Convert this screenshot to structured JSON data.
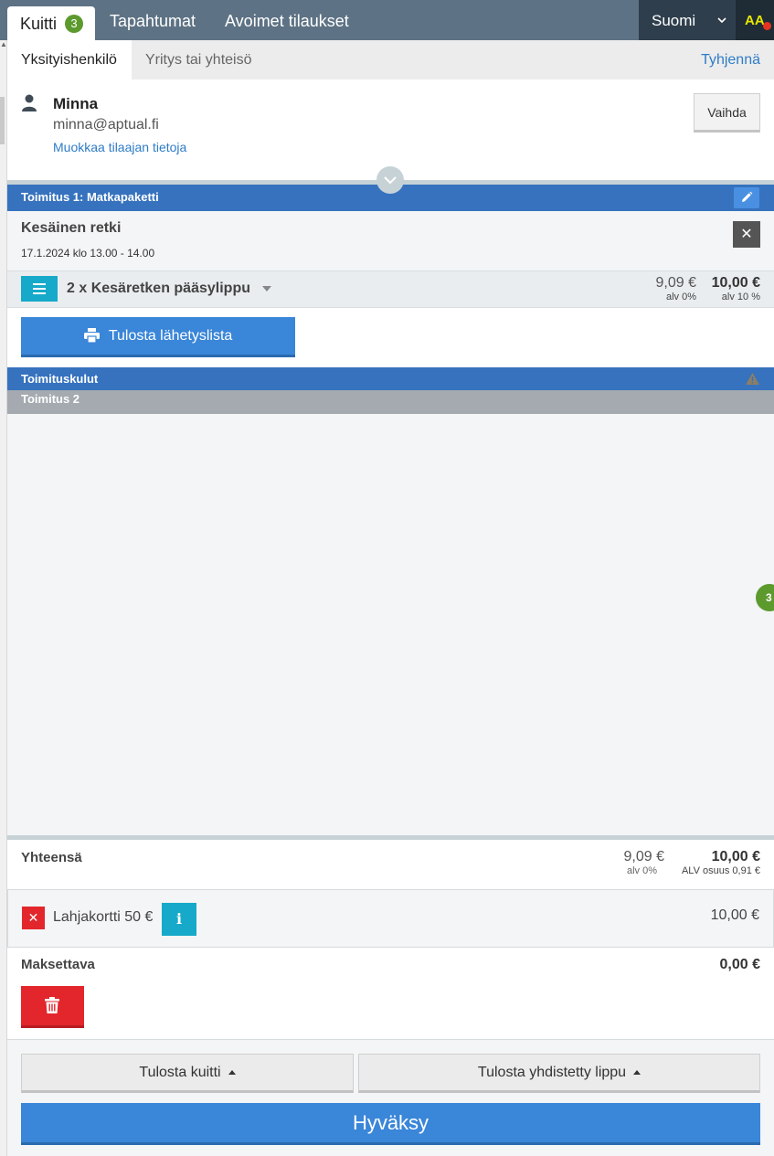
{
  "topbar": {
    "tabs": [
      {
        "label": "Kuitti",
        "badge": "3"
      },
      {
        "label": "Tapahtumat"
      },
      {
        "label": "Avoimet tilaukset"
      }
    ],
    "language": "Suomi",
    "font_size_toggle": "AA"
  },
  "customer_tabs": {
    "private": "Yksityishenkilö",
    "company": "Yritys tai yhteisö",
    "clear": "Tyhjennä"
  },
  "customer": {
    "name": "Minna",
    "email": "minna@aptual.fi",
    "edit_link": "Muokkaa tilaajan tietoja",
    "change_button": "Vaihda"
  },
  "delivery1": {
    "title": "Toimitus 1: Matkapaketti",
    "event_title": "Kesäinen retki",
    "event_time": "17.1.2024 klo 13.00 - 14.00",
    "ticket": {
      "label": "2 x Kesäretken pääsylippu",
      "price_net": "9,09 €",
      "vat_net": "alv 0%",
      "price_gross": "10,00 €",
      "vat_gross": "alv 10 %"
    },
    "print_send_list": "Tulosta lähetyslista"
  },
  "delivery_fees": {
    "title": "Toimituskulut"
  },
  "delivery2": {
    "title": "Toimitus 2"
  },
  "side_badge": "3",
  "totals": {
    "label": "Yhteensä",
    "net": "9,09 €",
    "net_vat": "alv 0%",
    "gross": "10,00 €",
    "vat_share": "ALV osuus 0,91 €"
  },
  "gift_card": {
    "label": "Lahjakortti 50 €",
    "info": "i",
    "amount": "10,00 €"
  },
  "payable": {
    "label": "Maksettava",
    "amount": "0,00 €"
  },
  "footer": {
    "print_receipt": "Tulosta kuitti",
    "print_combined": "Tulosta yhdistetty lippu",
    "approve": "Hyväksy"
  },
  "colors": {
    "topbar": "#5d7284",
    "accent_blue": "#3672be",
    "button_blue": "#3a86d8",
    "cyan": "#16a9c9",
    "red": "#e2262c",
    "green_badge": "#5c9a2e"
  }
}
